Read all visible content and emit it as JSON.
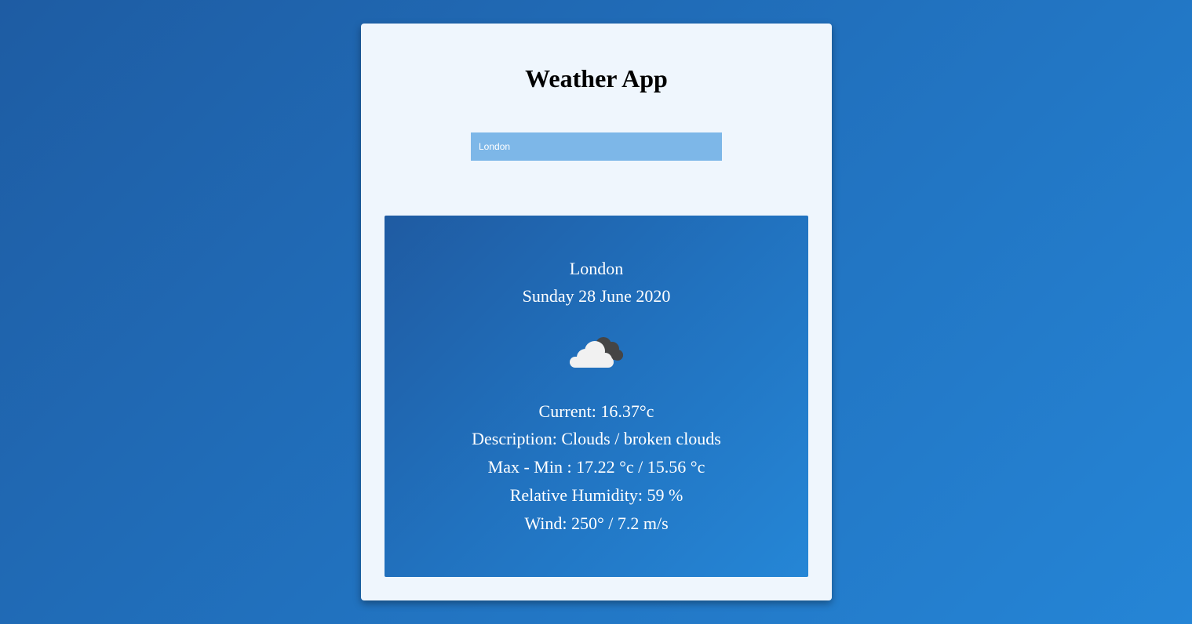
{
  "app": {
    "title": "Weather App"
  },
  "search": {
    "value": "London",
    "placeholder": ""
  },
  "weather": {
    "city": "London",
    "date": "Sunday 28 June 2020",
    "icon": "broken-clouds-icon",
    "current": "Current: 16.37°c",
    "description": "Description: Clouds / broken clouds",
    "max_min": "Max - Min : 17.22 °c / 15.56 °c",
    "humidity": "Relative Humidity: 59 %",
    "wind": "Wind: 250° / 7.2 m/s"
  },
  "colors": {
    "background_start": "#1e5ca3",
    "background_end": "#2585d6",
    "card": "#eff6fd",
    "search_field": "#7db7e8",
    "cloud_light": "#f1f1f1",
    "cloud_dark": "#454545"
  }
}
